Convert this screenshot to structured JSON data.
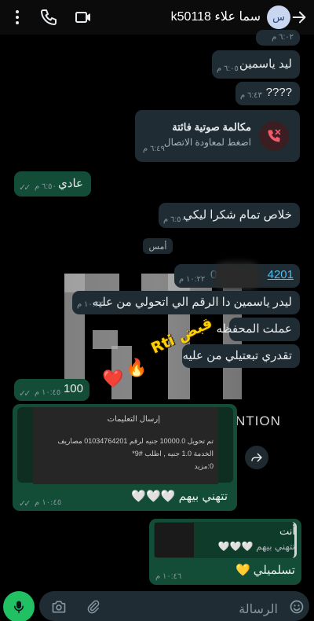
{
  "header": {
    "avatar_initials": "س",
    "title": "سما علاء k50118",
    "icons": [
      "back-arrow-icon",
      "video-call-icon",
      "phone-call-icon"
    ]
  },
  "messages": {
    "m0": {
      "time": "٦:٠٢ م"
    },
    "m1": {
      "text": "ليد ياسمين",
      "time": "٦:٠٥ م"
    },
    "m2": {
      "text": "????",
      "time": "٦:٤٣ م"
    },
    "call": {
      "title": "مكالمة صوتية فائتة",
      "subtitle": "اضغط لمعاودة الاتصال",
      "time": "٦:٤٩ م"
    },
    "m3": {
      "text": "عادي",
      "time": "٦:٥٠ م"
    },
    "m4": {
      "text": "خلاص تمام شكرا ليكي",
      "time": "٦:٥٠ م"
    },
    "date_chip": "أمس",
    "m5": {
      "text": "01...4201",
      "visible_text": "4201",
      "prefix": "0",
      "time": "١٠:٢٢ م"
    },
    "m6": {
      "text": "ليدر ياسمين دا الرقم الي اتحولي من عليه",
      "time": "١٠:٢٢ م"
    },
    "m7": {
      "text": "عملت المحفظه"
    },
    "m8": {
      "text": "تقدري تبعتيلي من عليه"
    },
    "m9": {
      "text": "100",
      "time": "١٠:٤٥ م"
    },
    "shot": {
      "card_title": "إرسال التعليمات",
      "card_body_1": "تم تحويل 10000.0 جنيه لرقم 01034764201 مصاريف",
      "card_body_2": "الخدمة 1.0 جنيه , اطلب #9*",
      "card_body_3": "0:مزيد",
      "caption": "تتهني بيهم 🤍🤍🤍",
      "time": "١٠:٤٥ م"
    },
    "reply": {
      "quote_sender": "أنت",
      "quote_text": "تتهني بيهم 🤍🤍🤍",
      "text": "تسلميلي 💛",
      "time": "١٠:٤٦ م"
    }
  },
  "sticker": {
    "text": "قبض Rti",
    "emoji_1": "🔥",
    "emoji_2": "❤️"
  },
  "background_logo": {
    "caption": "NTION"
  },
  "input": {
    "placeholder": "الرسالة"
  },
  "colors": {
    "outgoing_bubble": "#134d37",
    "incoming_bubble": "#1f2c34",
    "mic_button": "#21c063",
    "link": "#53bdeb",
    "missed_call": "#f15c6d"
  }
}
